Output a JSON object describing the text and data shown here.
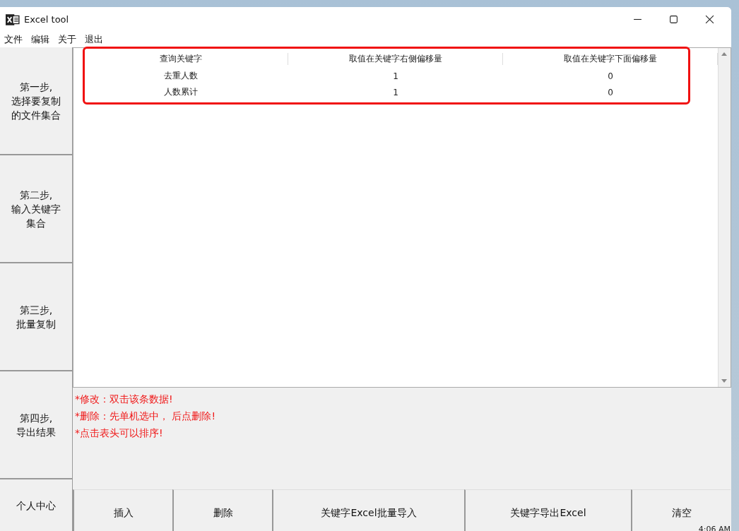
{
  "window": {
    "title": "Excel tool"
  },
  "menu": [
    "文件",
    "编辑",
    "关于",
    "退出"
  ],
  "sidebar": [
    {
      "lines": [
        "第一步,",
        "选择要复制",
        "的文件集合"
      ]
    },
    {
      "lines": [
        "第二步,",
        "输入关键字",
        "集合"
      ]
    },
    {
      "lines": [
        "第三步,",
        "批量复制"
      ]
    },
    {
      "lines": [
        "第四步,",
        "导出结果"
      ]
    },
    {
      "lines": [
        "个人中心"
      ]
    }
  ],
  "table": {
    "columns": [
      "查询关键字",
      "取值在关键字右侧偏移量",
      "取值在关键字下面偏移量"
    ],
    "rows": [
      [
        "去重人数",
        "1",
        "0"
      ],
      [
        "人数累计",
        "1",
        "0"
      ]
    ]
  },
  "notes": [
    "*修改：双击该条数据!",
    "*删除：先单机选中， 后点删除!",
    "*点击表头可以排序!"
  ],
  "buttons": [
    "插入",
    "删除",
    "关键字Excel批量导入",
    "关键字导出Excel",
    "清空"
  ],
  "clock": "4:06 AM"
}
